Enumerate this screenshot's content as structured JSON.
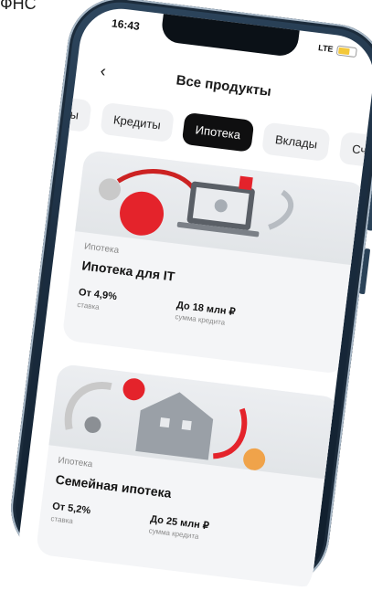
{
  "caption": "ФНС",
  "status_bar": {
    "time": "16:43",
    "network": "LTE"
  },
  "header": {
    "title": "Все продукты"
  },
  "tabs": [
    {
      "label": "ы",
      "active": false
    },
    {
      "label": "Кредиты",
      "active": false
    },
    {
      "label": "Ипотека",
      "active": true
    },
    {
      "label": "Вклады",
      "active": false
    },
    {
      "label": "Сч",
      "active": false
    }
  ],
  "products": [
    {
      "category": "Ипотека",
      "title": "Ипотека для IT",
      "rate_value": "От 4,9%",
      "rate_caption": "ставка",
      "amount_value": "До 18 млн ₽",
      "amount_caption": "сумма кредита"
    },
    {
      "category": "Ипотека",
      "title": "Семейная ипотека",
      "rate_value": "От 5,2%",
      "rate_caption": "ставка",
      "amount_value": "До 25 млн ₽",
      "amount_caption": "сумма кредита"
    }
  ],
  "colors": {
    "accent_red": "#e4232b",
    "tab_active_bg": "#0f0f10",
    "phone_frame": "#1b2d40"
  }
}
